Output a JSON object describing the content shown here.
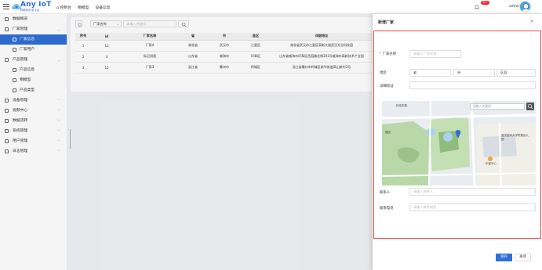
{
  "header": {
    "logo_text": "Any IoT",
    "logo_sub": "物联网开发平台",
    "nav": [
      "控制台",
      "物模型",
      "设备信息"
    ],
    "badge": "99+",
    "user": "admin"
  },
  "sidebar": {
    "items": [
      {
        "label": "数据概览",
        "icon": "monitor-icon"
      },
      {
        "label": "厂家管理",
        "icon": "factory-icon",
        "arrow": "︿"
      },
      {
        "label": "厂家信息",
        "icon": "gear-icon",
        "sub": true,
        "active": true
      },
      {
        "label": "厂家用户",
        "icon": "user-icon",
        "sub": true
      },
      {
        "label": "产品管理",
        "icon": "box-icon",
        "arrow": "︿"
      },
      {
        "label": "产品信息",
        "icon": "triangle-icon",
        "sub": true
      },
      {
        "label": "物模型",
        "icon": "model-icon",
        "sub": true
      },
      {
        "label": "产品类型",
        "icon": "type-icon",
        "sub": true
      },
      {
        "label": "设备管理",
        "icon": "device-icon",
        "arrow": "﹀"
      },
      {
        "label": "视频中心",
        "icon": "video-icon",
        "arrow": "﹀"
      },
      {
        "label": "数据流转",
        "icon": "flow-icon",
        "arrow": "﹀"
      },
      {
        "label": "系统管理",
        "icon": "system-icon",
        "arrow": "﹀"
      },
      {
        "label": "用户管理",
        "icon": "users-icon",
        "arrow": "﹀"
      },
      {
        "label": "日志管理",
        "icon": "log-icon",
        "arrow": "﹀"
      }
    ]
  },
  "toolbar": {
    "filter_field": "厂家名称",
    "search_placeholder": "请输入关键词"
  },
  "table": {
    "columns": [
      "序号",
      "id",
      "厂家名称",
      "省",
      "市",
      "县区",
      "详细地址"
    ],
    "rows": [
      [
        "1",
        "11",
        "厂家4",
        "湖北省",
        "武汉市",
        "江夏区",
        "湖北省武汉市江夏区高新大道武汉光谷科技园"
      ],
      [
        "2",
        "3",
        "标记测速",
        "山东省",
        "威海市",
        "环翠区",
        "山东省威海市环翠区西园路北侧201号威海市高新技术产业园"
      ],
      [
        "3",
        "15",
        "厂家3",
        "浙江省",
        "衢州市",
        "柯城区",
        "浙江省衢州市柯城区新华街道高山新村3号"
      ]
    ]
  },
  "drawer": {
    "title": "新增厂家",
    "name_label": "厂家名称",
    "name_placeholder": "请输入厂家名称",
    "region_label": "地区",
    "province": "省",
    "city": "市",
    "district": "区县",
    "address_label": "详细地址",
    "map_search_placeholder": "请输入关键词",
    "map_labels": [
      "科技东路",
      "福田",
      "重庆医科大学附属幼儿园",
      "乐客中心"
    ],
    "contact_label": "联系人",
    "contact_placeholder": "请输入联系人",
    "phone_label": "联系电话",
    "phone_placeholder": "请输入联系电话",
    "save": "保存",
    "close": "关闭"
  },
  "colors": {
    "primary": "#2f6fd6",
    "danger": "#f5222d"
  }
}
